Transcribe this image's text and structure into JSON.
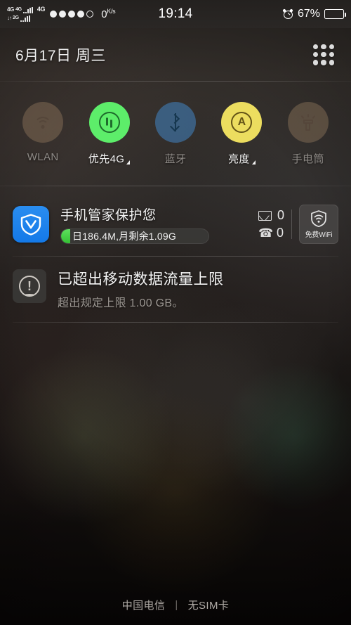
{
  "status_bar": {
    "sim1_net": "4G",
    "sim1_net2": "4G",
    "sim2_net": "2G",
    "data_arrows": "↓↑",
    "network_badge": "4G",
    "data_speed": "0",
    "data_speed_unit": "K/s",
    "time": "19:14",
    "alarm_icon": "alarm-clock-icon",
    "battery_percent": "67%",
    "battery_level": 67
  },
  "header": {
    "date": "6月17日  周三",
    "grid_button": "app-grid-icon"
  },
  "toggles": [
    {
      "label": "WLAN",
      "icon": "wifi-icon",
      "state": "off",
      "has_caret": false,
      "color": "#96785f"
    },
    {
      "label": "优先4G",
      "icon": "mobile-data-icon",
      "state": "on",
      "has_caret": true,
      "color": "#5ded6a"
    },
    {
      "label": "蓝牙",
      "icon": "bluetooth-icon",
      "state": "off",
      "has_caret": false,
      "color": "#3e70a0"
    },
    {
      "label": "亮度",
      "icon": "brightness-auto-icon",
      "state": "on",
      "has_caret": true,
      "color": "#ecdd5f"
    },
    {
      "label": "手电筒",
      "icon": "flashlight-icon",
      "state": "off",
      "has_caret": false,
      "color": "#96785f"
    }
  ],
  "security_card": {
    "app_icon": "tencent-manager-shield-icon",
    "title": "手机管家保护您",
    "usage_text": "日186.4M,月剩余1.09G",
    "usage_fill_percent": 6,
    "mail_icon": "envelope-icon",
    "mail_count": "0",
    "call_icon": "phone-icon",
    "call_count": "0",
    "wifi_button_icon": "wifi-shield-icon",
    "wifi_button_label": "免费WiFi"
  },
  "notification": {
    "icon": "alert-exclamation-icon",
    "title": "已超出移动数据流量上限",
    "body": "超出规定上限 1.00 GB。"
  },
  "footer": {
    "carrier": "中国电信",
    "separator": "|",
    "sim_status": "无SIM卡"
  }
}
